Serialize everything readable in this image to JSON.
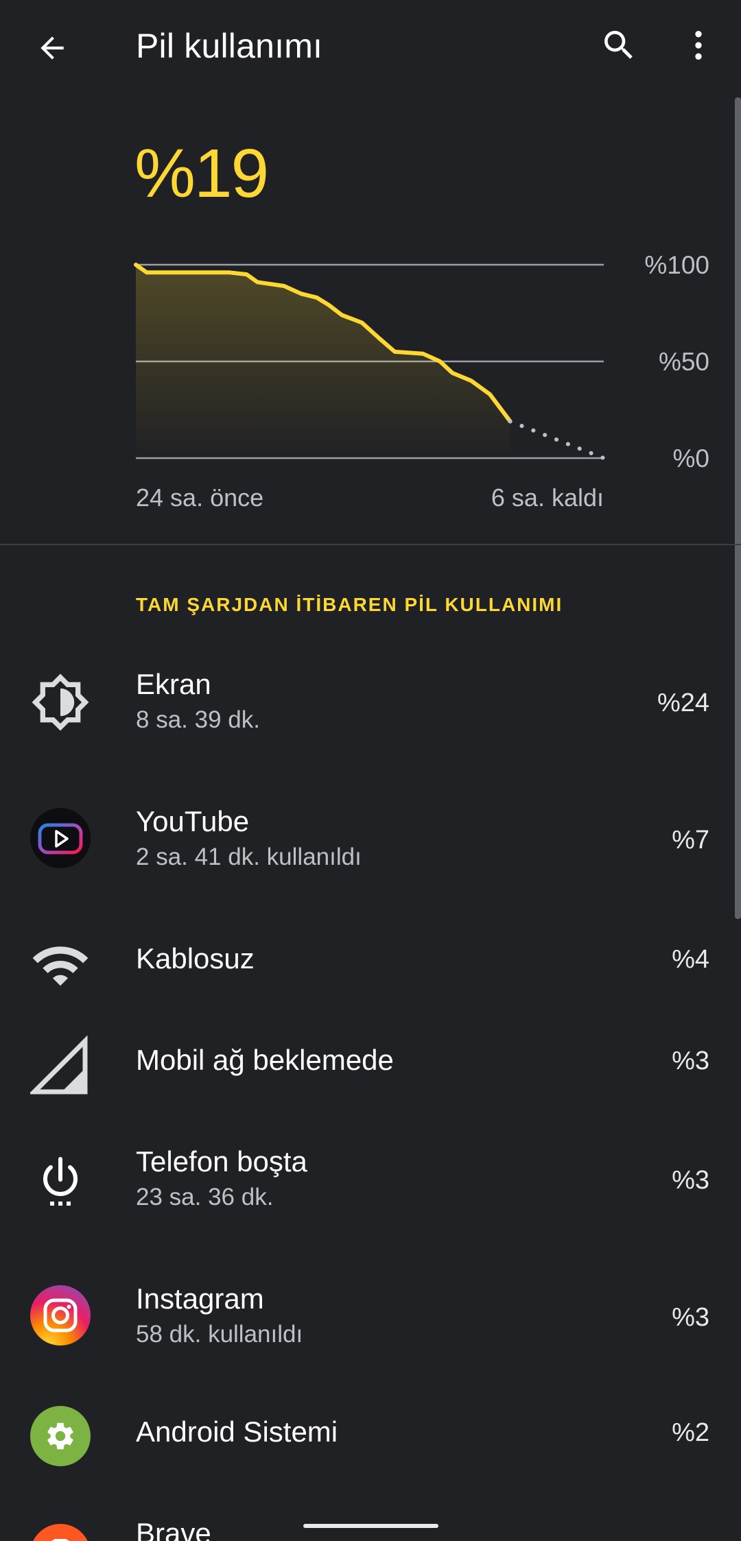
{
  "header": {
    "title": "Pil kullanımı",
    "back_icon": "arrow-back-icon",
    "search_icon": "search-icon",
    "more_icon": "more-vert-icon"
  },
  "battery": {
    "level_text": "%19"
  },
  "chart_data": {
    "type": "line",
    "y_tick_labels": [
      "%100",
      "%50",
      "%0"
    ],
    "ylim": [
      0,
      100
    ],
    "x_label_start": "24 sa. önce",
    "x_label_end": "6 sa. kaldı",
    "x_range_hours": [
      -24,
      6
    ],
    "series": [
      {
        "style": "solid",
        "color": "#fdd835",
        "points": [
          [
            -24.0,
            100
          ],
          [
            -23.3,
            96
          ],
          [
            -22.0,
            96
          ],
          [
            -20.0,
            96
          ],
          [
            -18.0,
            96
          ],
          [
            -16.9,
            95
          ],
          [
            -16.2,
            91
          ],
          [
            -14.5,
            89
          ],
          [
            -13.4,
            85
          ],
          [
            -12.4,
            83
          ],
          [
            -11.6,
            79
          ],
          [
            -10.8,
            74
          ],
          [
            -9.5,
            70
          ],
          [
            -8.4,
            62
          ],
          [
            -7.4,
            55
          ],
          [
            -5.6,
            54
          ],
          [
            -4.5,
            50
          ],
          [
            -3.7,
            44
          ],
          [
            -2.5,
            40
          ],
          [
            -1.3,
            33
          ],
          [
            0.0,
            19
          ]
        ]
      },
      {
        "style": "dotted",
        "color": "#bdc1c6",
        "points": [
          [
            0.0,
            19
          ],
          [
            6.0,
            0
          ]
        ]
      }
    ],
    "grid": true
  },
  "section": {
    "title": "TAM ŞARJDAN İTİBAREN PİL KULLANIMI"
  },
  "usage_items": [
    {
      "icon": "display-brightness-icon",
      "title": "Ekran",
      "subtitle": "8 sa. 39 dk.",
      "percent": "%24"
    },
    {
      "icon": "youtube-vanced-icon",
      "title": "YouTube",
      "subtitle": "2 sa. 41 dk. kullanıldı",
      "percent": "%7"
    },
    {
      "icon": "wifi-icon",
      "title": "Kablosuz",
      "subtitle": "",
      "percent": "%4"
    },
    {
      "icon": "cellular-signal-icon",
      "title": "Mobil ağ beklemede",
      "subtitle": "",
      "percent": "%3"
    },
    {
      "icon": "power-idle-icon",
      "title": "Telefon boşta",
      "subtitle": "23 sa. 36 dk.",
      "percent": "%3"
    },
    {
      "icon": "instagram-icon",
      "title": "Instagram",
      "subtitle": "58 dk. kullanıldı",
      "percent": "%3"
    },
    {
      "icon": "android-system-gear-icon",
      "title": "Android Sistemi",
      "subtitle": "",
      "percent": "%2"
    },
    {
      "icon": "brave-icon",
      "title": "Brave",
      "subtitle": "",
      "percent": ""
    }
  ],
  "colors": {
    "background": "#202124",
    "accent": "#fdd835",
    "text_primary": "#ffffff",
    "text_secondary": "#bdc1c6"
  }
}
